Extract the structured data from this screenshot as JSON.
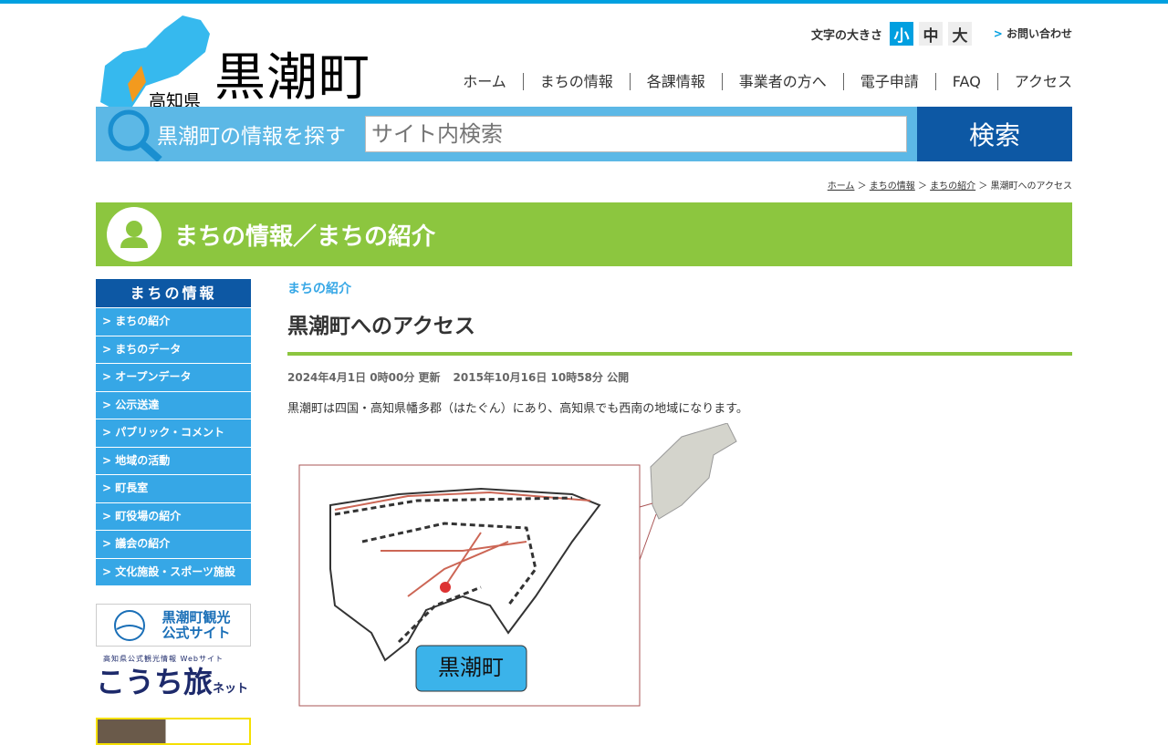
{
  "header": {
    "prefecture": "高知県",
    "town": "黒潮町",
    "font_size_label": "文字の大きさ",
    "font_sizes": [
      "小",
      "中",
      "大"
    ],
    "contact": "お問い合わせ"
  },
  "nav": [
    "ホーム",
    "まちの情報",
    "各課情報",
    "事業者の方へ",
    "電子申請",
    "FAQ",
    "アクセス"
  ],
  "search": {
    "label": "黒潮町の情報を探す",
    "placeholder": "サイト内検索",
    "button": "検索"
  },
  "breadcrumb": [
    "ホーム",
    "まちの情報",
    "まちの紹介",
    "黒潮町へのアクセス"
  ],
  "banner_title": "まちの情報／まちの紹介",
  "sidebar": {
    "heading": "まちの情報",
    "items": [
      "まちの紹介",
      "まちのデータ",
      "オープンデータ",
      "公示送達",
      "パブリック・コメント",
      "地域の活動",
      "町長室",
      "町役場の紹介",
      "議会の紹介",
      "文化施設・スポーツ施設"
    ],
    "banner1": "黒潮町観光 公式サイト",
    "banner2_sub": "高知県公式観光情報 Webサイト",
    "banner2_main": "こうち旅",
    "banner2_tail": "ネット"
  },
  "main": {
    "category": "まちの紹介",
    "title": "黒潮町へのアクセス",
    "updated": "2024年4月1日 0時00分 更新",
    "published": "2015年10月16日 10時58分 公開",
    "description": "黒潮町は四国・高知県幡多郡（はたぐん）にあり、高知県でも西南の地域になります。",
    "map_label": "黒潮町"
  }
}
